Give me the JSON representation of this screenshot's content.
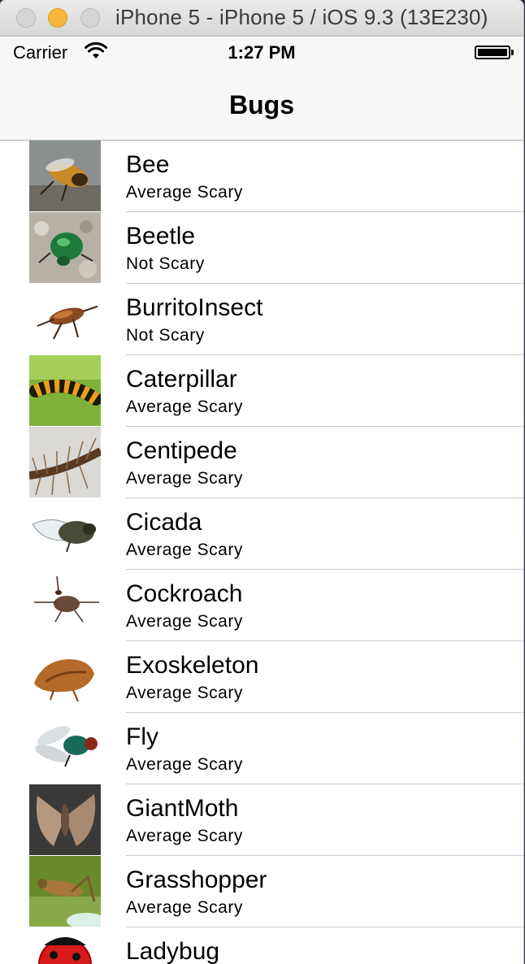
{
  "window": {
    "title": "iPhone 5 - iPhone 5 / iOS 9.3 (13E230)"
  },
  "status_bar": {
    "carrier": "Carrier",
    "time": "1:27 PM",
    "wifi_icon": "wifi-icon",
    "battery_icon": "battery-icon"
  },
  "nav": {
    "title": "Bugs"
  },
  "bugs": [
    {
      "name": "Bee",
      "scariness": "Average Scary",
      "image": "bee-photo"
    },
    {
      "name": "Beetle",
      "scariness": "Not Scary",
      "image": "beetle-photo"
    },
    {
      "name": "BurritoInsect",
      "scariness": "Not Scary",
      "image": "burrito-insect-photo"
    },
    {
      "name": "Caterpillar",
      "scariness": "Average Scary",
      "image": "caterpillar-photo"
    },
    {
      "name": "Centipede",
      "scariness": "Average Scary",
      "image": "centipede-photo"
    },
    {
      "name": "Cicada",
      "scariness": "Average Scary",
      "image": "cicada-photo"
    },
    {
      "name": "Cockroach",
      "scariness": "Average Scary",
      "image": "cockroach-photo"
    },
    {
      "name": "Exoskeleton",
      "scariness": "Average Scary",
      "image": "exoskeleton-photo"
    },
    {
      "name": "Fly",
      "scariness": "Average Scary",
      "image": "fly-photo"
    },
    {
      "name": "GiantMoth",
      "scariness": "Average Scary",
      "image": "giant-moth-photo"
    },
    {
      "name": "Grasshopper",
      "scariness": "Average Scary",
      "image": "grasshopper-photo"
    },
    {
      "name": "Ladybug",
      "scariness": "",
      "image": "ladybug-photo"
    }
  ]
}
